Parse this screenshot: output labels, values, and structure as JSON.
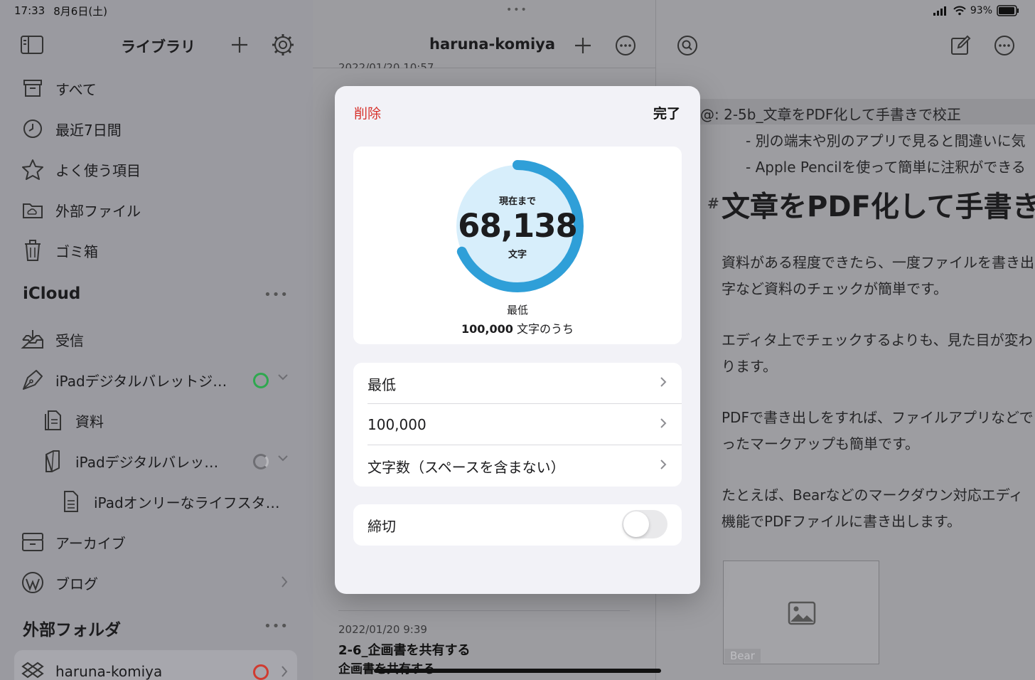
{
  "status": {
    "time": "17:33",
    "date": "8月6日(土)",
    "battery": "93%"
  },
  "sidebar": {
    "title": "ライブラリ",
    "items": [
      {
        "label": "すべて"
      },
      {
        "label": "最近7日間"
      },
      {
        "label": "よく使う項目"
      },
      {
        "label": "外部ファイル"
      },
      {
        "label": "ゴミ箱"
      }
    ],
    "icloud": {
      "title": "iCloud",
      "items": [
        {
          "label": "受信"
        },
        {
          "label": "iPadデジタルバレットジ…"
        },
        {
          "label": "資料"
        },
        {
          "label": "iPadデジタルバレッ…"
        },
        {
          "label": "iPadオンリーなライフスタ…"
        },
        {
          "label": "アーカイブ"
        },
        {
          "label": "ブログ"
        }
      ]
    },
    "external": {
      "title": "外部フォルダ",
      "items": [
        {
          "label": "haruna-komiya"
        }
      ]
    },
    "more": "•••"
  },
  "middle": {
    "title": "haruna-komiya",
    "top_date": "2022/01/20 10:57",
    "notes": [
      {
        "date": "2022/01/20 9:39",
        "title": "2-6_企画書を共有する",
        "subtitle": "企画書を共有する"
      }
    ]
  },
  "editor": {
    "lines": [
      "@: 2-5b_文章をPDF化して手書きで校正",
      "- 別の端末や別のアプリで見ると間違いに気",
      "- Apple Pencilを使って簡単に注釈ができる"
    ],
    "hash": "#",
    "heading": "文章をPDF化して手書き",
    "paragraphs": [
      "資料がある程度できたら、一度ファイルを書き出",
      "字など資料のチェックが簡単です。",
      "エディタ上でチェックするよりも、見た目が変わ",
      "ります。",
      "PDFで書き出しをすれば、ファイルアプリなどで",
      "ったマークアップも簡単です。",
      "たとえば、Bearなどのマークダウン対応エディ",
      "機能でPDFファイルに書き出します。"
    ],
    "image_tag": "Bear"
  },
  "modal": {
    "delete": "削除",
    "done": "完了",
    "goal": {
      "label_top": "現在まで",
      "value": "68,138",
      "unit": "文字",
      "caption": "最低",
      "target": "100,000",
      "target_suffix": " 文字のうち",
      "progress": 0.68138
    },
    "settings": [
      {
        "label": "最低"
      },
      {
        "label": "100,000"
      },
      {
        "label": "文字数（スペースを含まない）"
      }
    ],
    "deadline": {
      "label": "締切",
      "enabled": false
    }
  },
  "colors": {
    "ring": "#2f9fd8",
    "ring_fill": "#d7eefb",
    "delete": "#d7322c"
  }
}
